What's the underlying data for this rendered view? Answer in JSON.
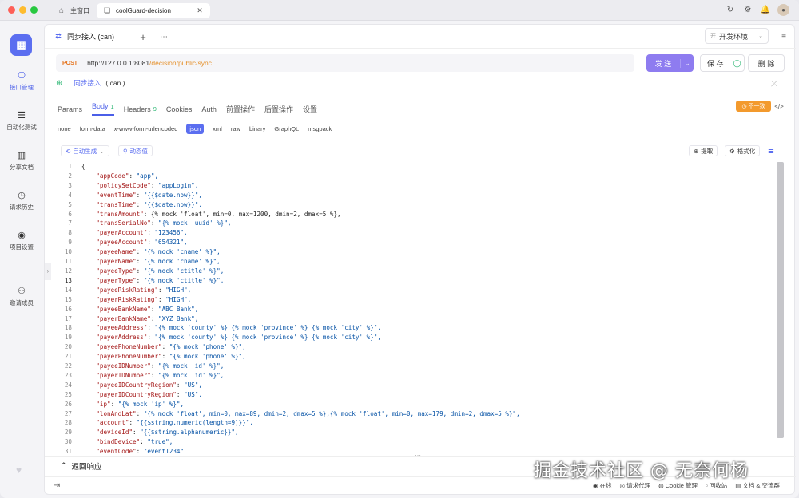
{
  "titlebar": {
    "tabs": [
      {
        "label": "主窗口"
      },
      {
        "label": "coolGuard-decision"
      }
    ]
  },
  "sidebar": {
    "items": [
      {
        "label": "接口管理",
        "icon": "api-icon"
      },
      {
        "label": "自动化测试",
        "icon": "stack-icon"
      },
      {
        "label": "分享文档",
        "icon": "book-icon"
      },
      {
        "label": "请求历史",
        "icon": "history-icon"
      },
      {
        "label": "项目设置",
        "icon": "settings-icon"
      },
      {
        "label": "邀请成员",
        "icon": "add-user-icon"
      }
    ]
  },
  "request_tab": {
    "label": "同步接入 (can)"
  },
  "environment": {
    "prefix": "开",
    "label": "开发环境"
  },
  "url": {
    "method": "POST",
    "base": "http://127.0.0.1:8081",
    "path": "/decision/public/sync"
  },
  "buttons": {
    "send": "发 送",
    "save": "保 存",
    "delete": "删 除"
  },
  "description": {
    "name": "同步接入",
    "suffix": "( can )"
  },
  "subtabs": [
    {
      "label": "Params",
      "count": ""
    },
    {
      "label": "Body",
      "count": "1"
    },
    {
      "label": "Headers",
      "count": "9"
    },
    {
      "label": "Cookies",
      "count": ""
    },
    {
      "label": "Auth",
      "count": ""
    },
    {
      "label": "前置操作",
      "count": ""
    },
    {
      "label": "后置操作",
      "count": ""
    },
    {
      "label": "设置",
      "count": ""
    }
  ],
  "inconsistent_badge": "不一致",
  "body_types": [
    "none",
    "form-data",
    "x-www-form-urlencoded",
    "json",
    "xml",
    "raw",
    "binary",
    "GraphQL",
    "msgpack"
  ],
  "body_type_selected": "json",
  "editor_toolbar": {
    "auto_generate": "自动生成",
    "dynamic_value": "动态值",
    "extract": "提取",
    "format": "格式化"
  },
  "code_lines": [
    {
      "n": "1",
      "text": "{"
    },
    {
      "n": "2",
      "key": "\"appCode\"",
      "val": "\"app\","
    },
    {
      "n": "3",
      "key": "\"policySetCode\"",
      "val": "\"appLogin\","
    },
    {
      "n": "4",
      "key": "\"eventTime\"",
      "val": "\"{{$date.now}}\","
    },
    {
      "n": "5",
      "key": "\"transTime\"",
      "val": "\"{{$date.now}}\","
    },
    {
      "n": "6",
      "key": "\"transAmount\"",
      "val": "{% mock 'float', min=0, max=1200, dmin=2, dmax=5 %},"
    },
    {
      "n": "7",
      "key": "\"transSerialNo\"",
      "val": "\"{% mock 'uuid' %}\","
    },
    {
      "n": "8",
      "key": "\"payerAccount\"",
      "val": "\"123456\","
    },
    {
      "n": "9",
      "key": "\"payeeAccount\"",
      "val": "\"654321\","
    },
    {
      "n": "10",
      "key": "\"payeeName\"",
      "val": "\"{% mock 'cname' %}\","
    },
    {
      "n": "11",
      "key": "\"payerName\"",
      "val": "\"{% mock 'cname' %}\","
    },
    {
      "n": "12",
      "key": "\"payeeType\"",
      "val": "\"{% mock 'ctitle' %}\","
    },
    {
      "n": "13",
      "key": "\"payerType\"",
      "val": "\"{% mock 'ctitle' %}\","
    },
    {
      "n": "14",
      "key": "\"payeeRiskRating\"",
      "val": "\"HIGH\","
    },
    {
      "n": "15",
      "key": "\"payerRiskRating\"",
      "val": "\"HIGH\","
    },
    {
      "n": "16",
      "key": "\"payeeBankName\"",
      "val": "\"ABC Bank\","
    },
    {
      "n": "17",
      "key": "\"payerBankName\"",
      "val": "\"XYZ Bank\","
    },
    {
      "n": "18",
      "key": "\"payeeAddress\"",
      "val": "\"{% mock 'county' %} {% mock 'province' %} {% mock 'city' %}\","
    },
    {
      "n": "19",
      "key": "\"payerAddress\"",
      "val": "\"{% mock 'county' %} {% mock 'province' %} {% mock 'city' %}\","
    },
    {
      "n": "20",
      "key": "\"payeePhoneNumber\"",
      "val": "\"{% mock 'phone' %}\","
    },
    {
      "n": "21",
      "key": "\"payerPhoneNumber\"",
      "val": "\"{% mock 'phone' %}\","
    },
    {
      "n": "22",
      "key": "\"payeeIDNumber\"",
      "val": "\"{% mock 'id' %}\","
    },
    {
      "n": "23",
      "key": "\"payerIDNumber\"",
      "val": "\"{% mock 'id' %}\","
    },
    {
      "n": "24",
      "key": "\"payeeIDCountryRegion\"",
      "val": "\"US\","
    },
    {
      "n": "25",
      "key": "\"payerIDCountryRegion\"",
      "val": "\"US\","
    },
    {
      "n": "26",
      "key": "\"ip\"",
      "val": "\"{% mock 'ip' %}\","
    },
    {
      "n": "27",
      "key": "\"lonAndLat\"",
      "val": "\"{% mock 'float', min=0, max=89, dmin=2, dmax=5 %},{% mock 'float', min=0, max=179, dmin=2, dmax=5 %}\","
    },
    {
      "n": "28",
      "key": "\"account\"",
      "val": "\"{{$string.numeric(length=9)}}\","
    },
    {
      "n": "29",
      "key": "\"deviceId\"",
      "val": "\"{{$string.alphanumeric}}\","
    },
    {
      "n": "30",
      "key": "\"bindDevice\"",
      "val": "\"true\","
    },
    {
      "n": "31",
      "key": "\"eventCode\"",
      "val": "\"event1234\""
    }
  ],
  "response": {
    "label": "返回响应"
  },
  "statusbar": {
    "items": [
      "在线",
      "请求代理",
      "Cookie 管理",
      "回收站",
      "文档 & 交流群"
    ]
  },
  "watermark": "掘金技术社区 @ 无奈何杨"
}
